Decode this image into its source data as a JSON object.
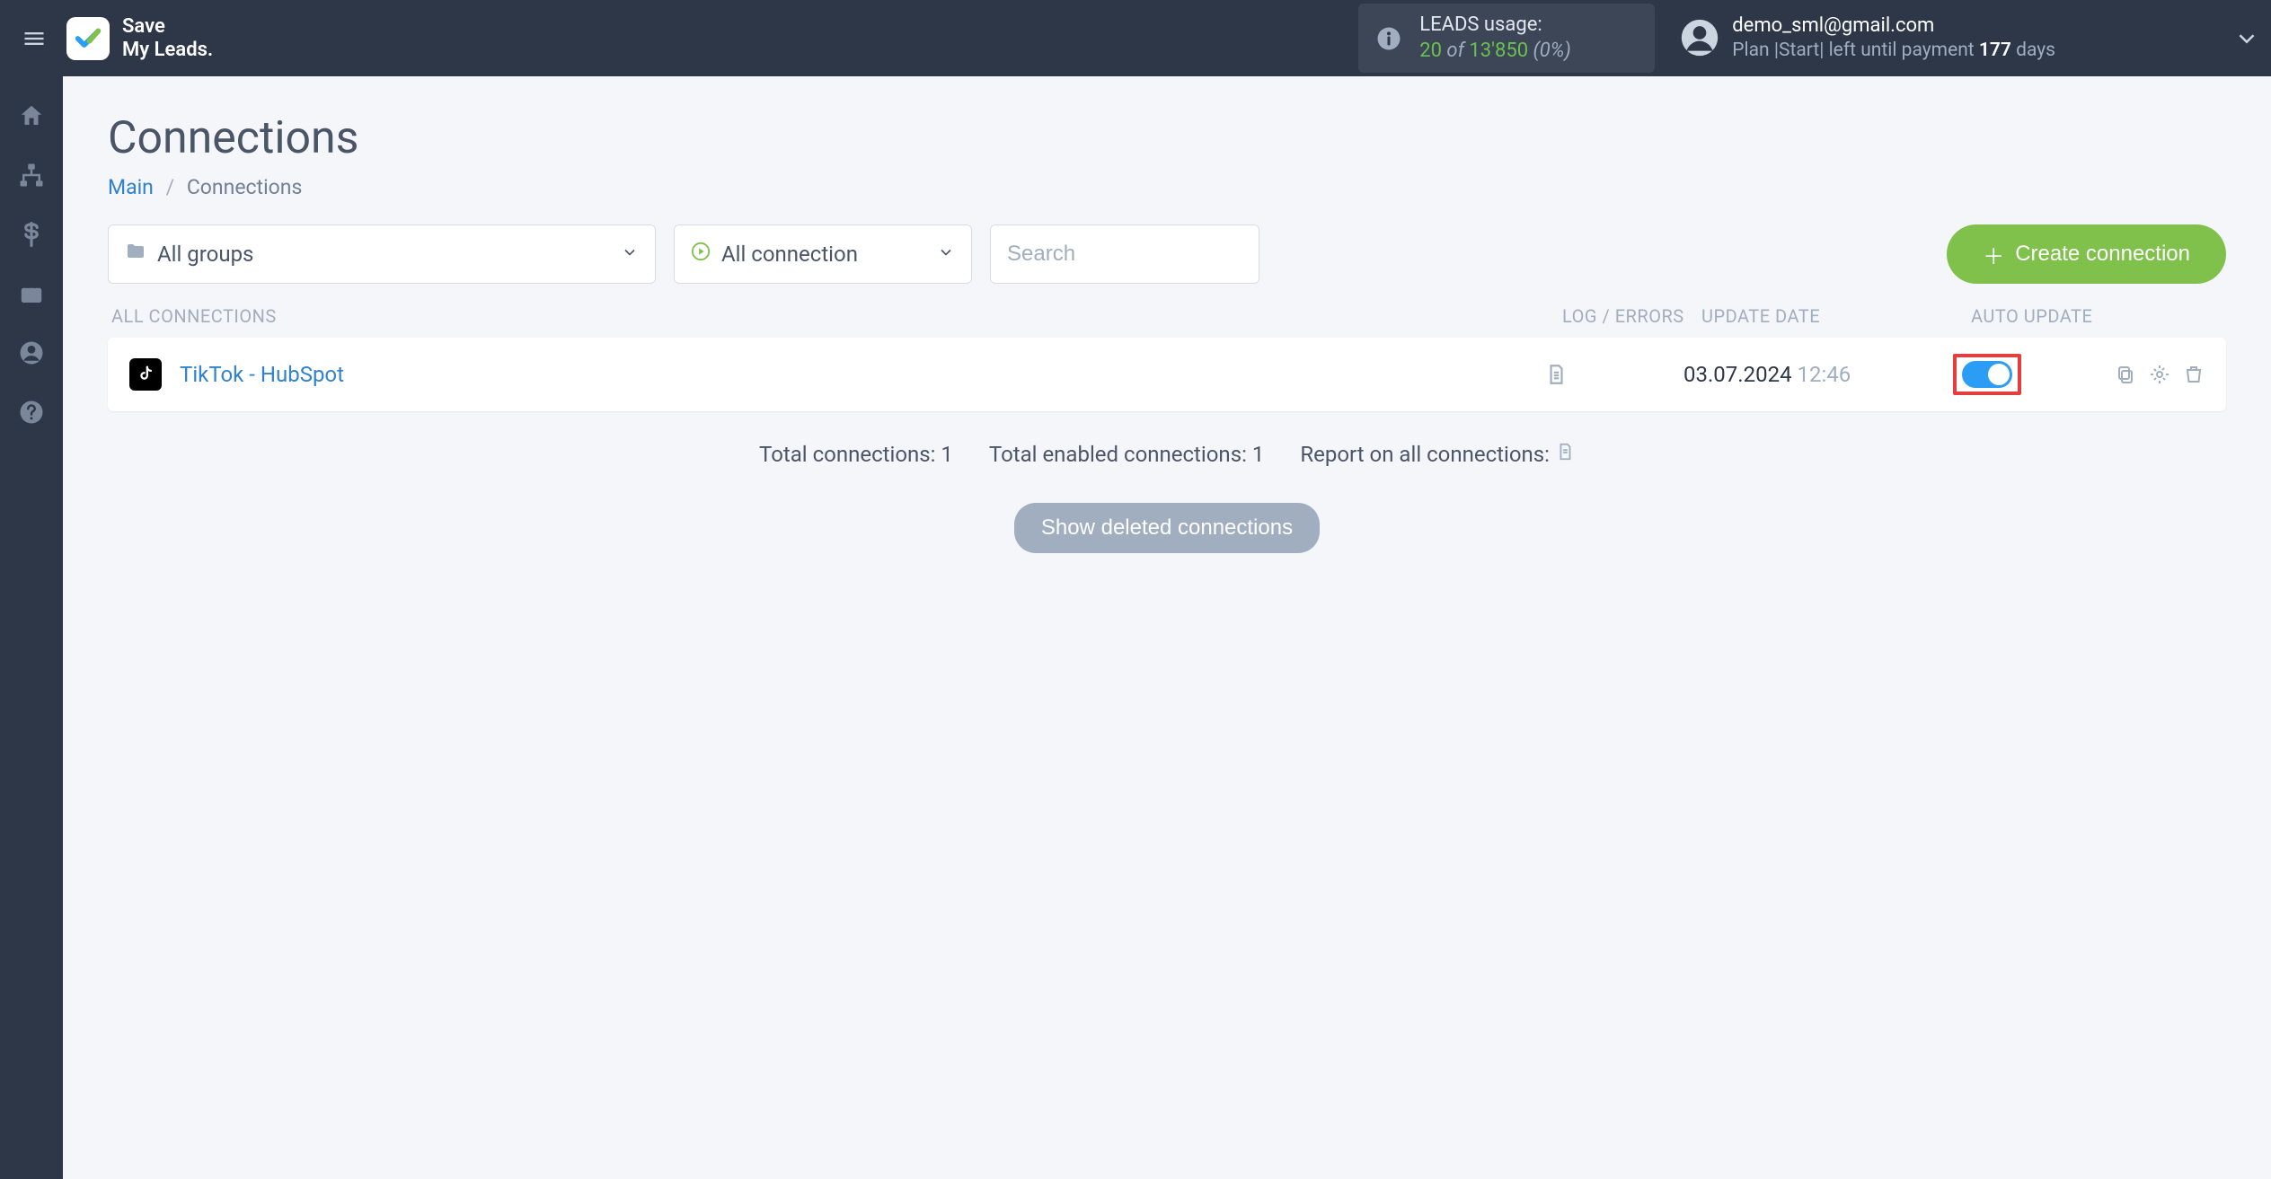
{
  "brand": {
    "line1": "Save",
    "line2": "My Leads."
  },
  "leads_usage": {
    "title": "LEADS usage:",
    "used": "20",
    "of": " of ",
    "total": "13'850",
    "pct": " (0%)"
  },
  "account": {
    "email": "demo_sml@gmail.com",
    "plan_prefix": "Plan |Start| left until payment ",
    "days_num": "177",
    "days_word": " days"
  },
  "page": {
    "title": "Connections"
  },
  "breadcrumb": {
    "main": "Main",
    "sep": "/",
    "current": "Connections"
  },
  "filters": {
    "groups": "All groups",
    "status": "All connection",
    "search_placeholder": "Search"
  },
  "buttons": {
    "create": "Create connection",
    "show_deleted": "Show deleted connections"
  },
  "table_headers": {
    "name": "ALL CONNECTIONS",
    "log": "LOG / ERRORS",
    "date": "UPDATE DATE",
    "auto": "AUTO UPDATE"
  },
  "connections": [
    {
      "name": "TikTok - HubSpot",
      "date": "03.07.2024",
      "time": "12:46"
    }
  ],
  "summary": {
    "total": "Total connections: 1",
    "enabled": "Total enabled connections: 1",
    "report": "Report on all connections:"
  }
}
